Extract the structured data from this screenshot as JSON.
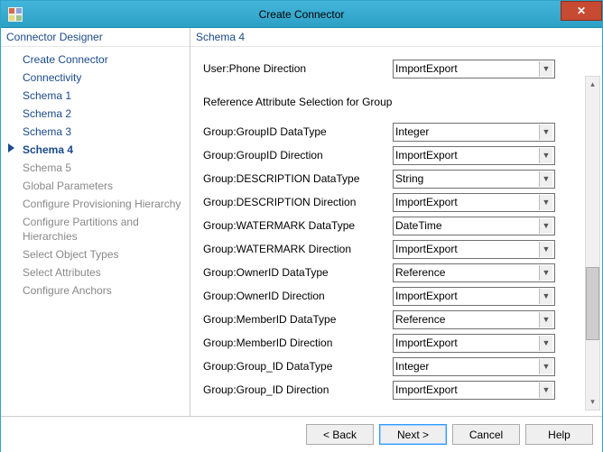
{
  "window": {
    "title": "Create Connector",
    "close_label": "✕"
  },
  "nav": {
    "header": "Connector Designer",
    "items": [
      {
        "label": "Create Connector",
        "state": "done"
      },
      {
        "label": "Connectivity",
        "state": "done"
      },
      {
        "label": "Schema 1",
        "state": "done"
      },
      {
        "label": "Schema 2",
        "state": "done"
      },
      {
        "label": "Schema 3",
        "state": "done"
      },
      {
        "label": "Schema 4",
        "state": "current"
      },
      {
        "label": "Schema 5",
        "state": "pending"
      },
      {
        "label": "Global Parameters",
        "state": "pending"
      },
      {
        "label": "Configure Provisioning Hierarchy",
        "state": "pending"
      },
      {
        "label": "Configure Partitions and Hierarchies",
        "state": "pending"
      },
      {
        "label": "Select Object Types",
        "state": "pending"
      },
      {
        "label": "Select Attributes",
        "state": "pending"
      },
      {
        "label": "Configure Anchors",
        "state": "pending"
      }
    ]
  },
  "content": {
    "header": "Schema 4",
    "top_rows": [
      {
        "label": "User:Phone Direction",
        "value": "ImportExport"
      }
    ],
    "section": "Reference Attribute Selection for Group",
    "rows": [
      {
        "label": "Group:GroupID DataType",
        "value": "Integer"
      },
      {
        "label": "Group:GroupID Direction",
        "value": "ImportExport"
      },
      {
        "label": "Group:DESCRIPTION DataType",
        "value": "String"
      },
      {
        "label": "Group:DESCRIPTION Direction",
        "value": "ImportExport"
      },
      {
        "label": "Group:WATERMARK DataType",
        "value": "DateTime"
      },
      {
        "label": "Group:WATERMARK Direction",
        "value": "ImportExport"
      },
      {
        "label": "Group:OwnerID DataType",
        "value": "Reference"
      },
      {
        "label": "Group:OwnerID Direction",
        "value": "ImportExport"
      },
      {
        "label": "Group:MemberID DataType",
        "value": "Reference"
      },
      {
        "label": "Group:MemberID Direction",
        "value": "ImportExport"
      },
      {
        "label": "Group:Group_ID DataType",
        "value": "Integer"
      },
      {
        "label": "Group:Group_ID Direction",
        "value": "ImportExport"
      }
    ]
  },
  "footer": {
    "back": "<  Back",
    "next": "Next  >",
    "cancel": "Cancel",
    "help": "Help"
  }
}
